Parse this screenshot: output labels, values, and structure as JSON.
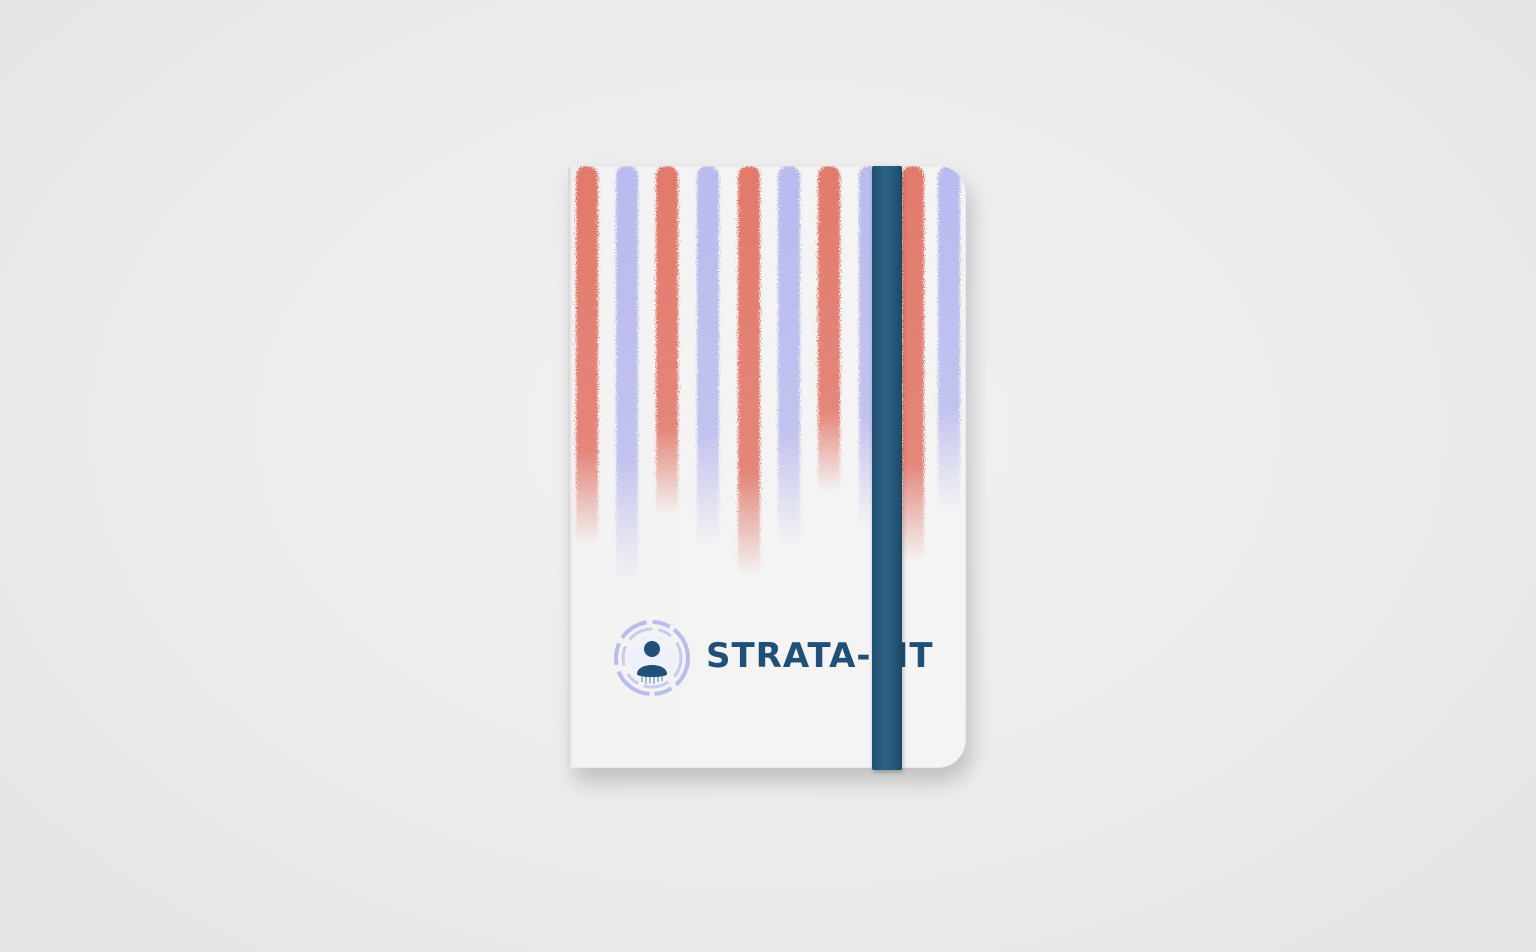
{
  "notebook": {
    "brand_name": "STRATA-FIT",
    "logo_icon": "person-in-circle-icon",
    "colors": {
      "brand_blue": "#205078",
      "band_blue": "#2a5d80",
      "stripe_coral": "#e07b6e",
      "stripe_lavender": "#bbbcec",
      "cover": "#f3f3f3"
    }
  }
}
